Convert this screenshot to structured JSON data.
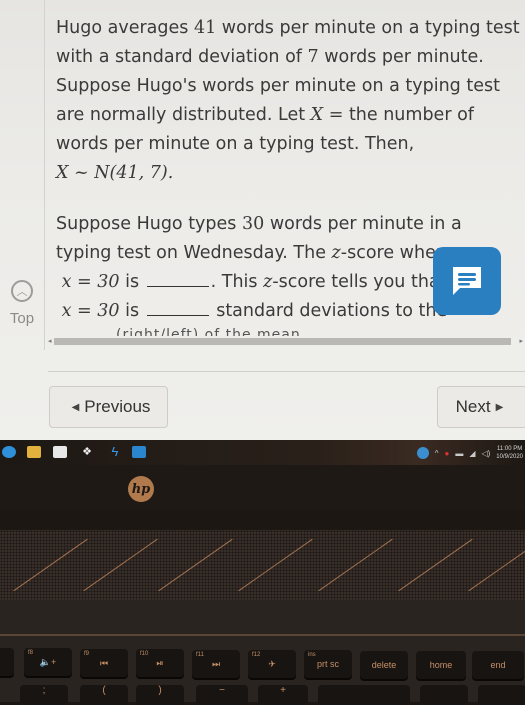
{
  "question": {
    "paragraph1": {
      "line1_pre": "Hugo averages ",
      "mean": "41",
      "line1_post": " words per minute on a typing test",
      "line2_pre": "with a standard deviation of ",
      "sd": "7",
      "line2_post": " words per minute.",
      "line3": "Suppose Hugo's words per minute on a typing test",
      "line4_pre": "are normally distributed. Let ",
      "var_X": "X",
      "line4_eq": " = ",
      "line4_post": "the number of",
      "line5": "words per minute on a typing test. Then,",
      "distribution": "X ~ N(41, 7)."
    },
    "paragraph2": {
      "line1_pre": "Suppose Hugo types ",
      "value": "30",
      "line1_post": " words per minute in a",
      "line2_pre": "typing test on Wednesday. The ",
      "z": "z",
      "line2_post": "-score wher",
      "line3_math": "x = 30",
      "line3_is": " is ",
      "line3_post_pre": ". This ",
      "line3_post": "-score tells you tha",
      "line4_math": "x = 30",
      "line4_is": " is ",
      "line4_post": "standard deviations to the",
      "line5_cut": "(right/left) of the mean"
    }
  },
  "sidebar": {
    "top_label": "Top",
    "top_icon": "chevron-up-circle-icon"
  },
  "chat": {
    "icon": "chat-message-icon",
    "color": "#2a7fc0"
  },
  "nav": {
    "previous_label": "Previous",
    "next_label": "Next"
  },
  "taskbar": {
    "apps": [
      "edge-icon",
      "file-explorer-icon",
      "store-icon",
      "dropbox-icon",
      "app-icon",
      "mail-icon"
    ],
    "time": "11:00 PM",
    "date": "10/9/2020"
  },
  "laptop": {
    "brand": "hp",
    "keys": [
      {
        "fn": "f8",
        "label": "🔈+"
      },
      {
        "fn": "f9",
        "label": "⏮"
      },
      {
        "fn": "f10",
        "label": "⏯"
      },
      {
        "fn": "f11",
        "label": "⏭"
      },
      {
        "fn": "f12",
        "label": "✈"
      },
      {
        "fn": "ins",
        "label": "prt sc"
      },
      {
        "fn": "",
        "label": "delete"
      },
      {
        "fn": "",
        "label": "home"
      },
      {
        "fn": "",
        "label": "end"
      }
    ],
    "row2_keys": [
      ";",
      "(",
      ")",
      "−",
      "+"
    ]
  }
}
